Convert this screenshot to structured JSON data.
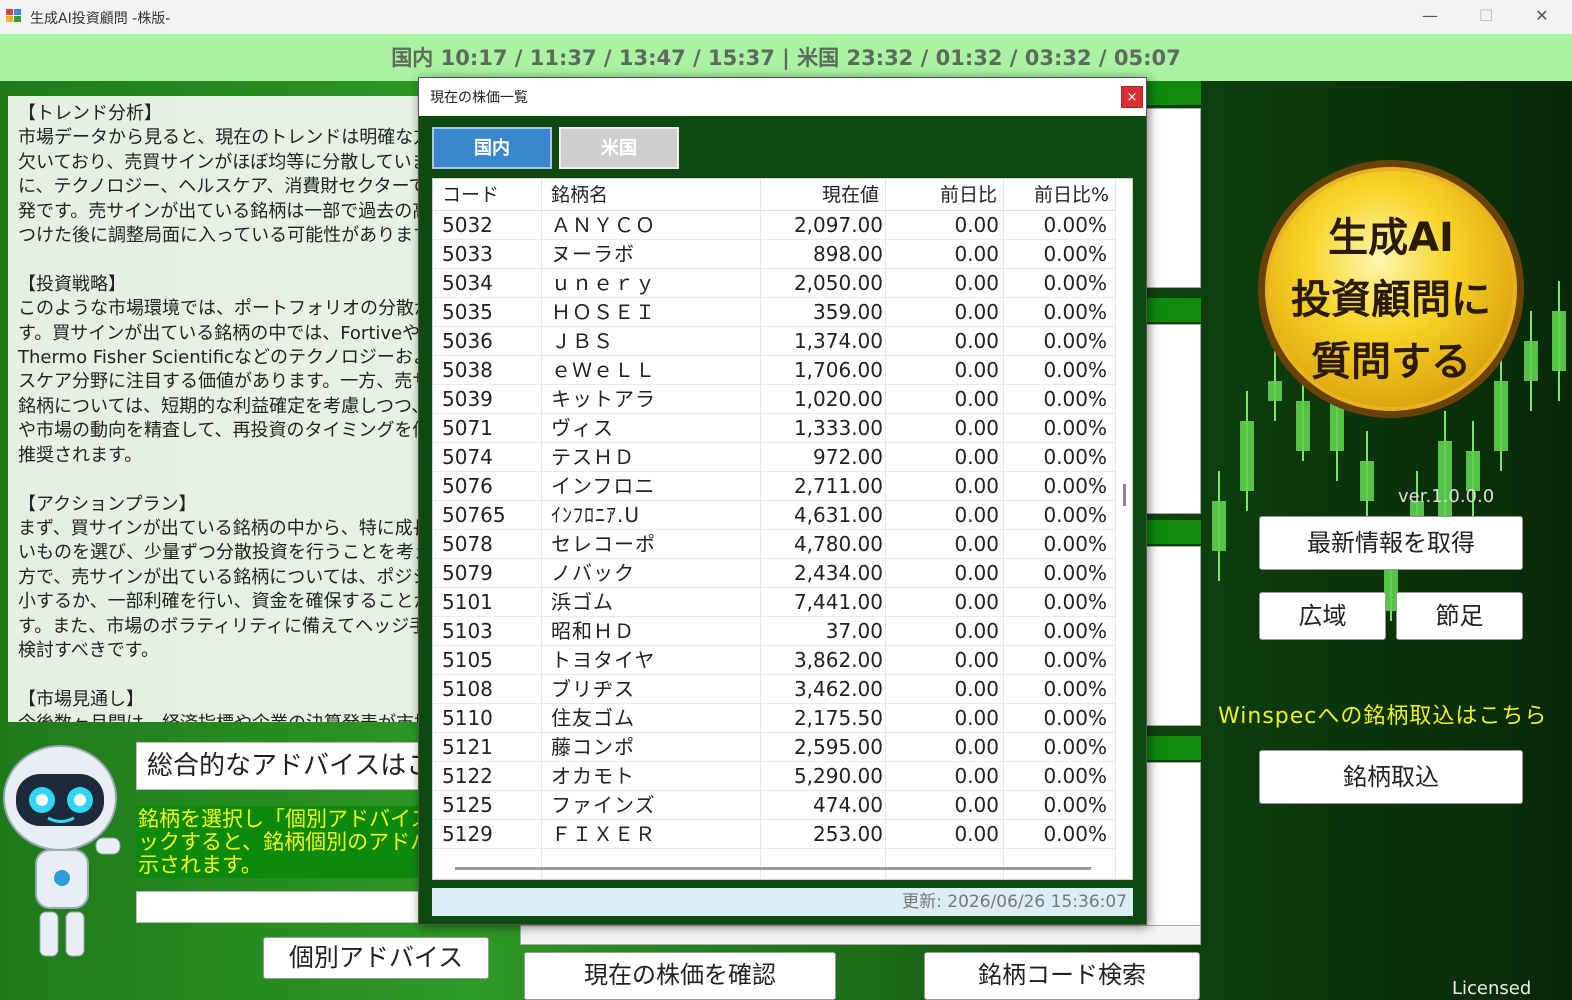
{
  "window": {
    "title": "生成AI投資顧問 -株版-",
    "minimize": "—",
    "maximize": "☐",
    "close": "✕"
  },
  "timebar": {
    "text": "国内 10:17 / 11:37 / 13:47 / 15:37  |  米国 23:32 / 01:32 / 03:32 / 05:07"
  },
  "analysis": {
    "text": "【トレンド分析】\n市場データから見ると、現在のトレンドは明確な方向性を\n欠いており、売買サインがほぼ均等に分散しています。特\nに、テクノロジー、ヘルスケア、消費財セクターでの売買が活\n発です。売サインが出ている銘柄は一部で過去の高値を\nつけた後に調整局面に入っている可能性があります。\n\n【投資戦略】\nこのような市場環境では、ポートフォリオの分散が重要で\nす。買サインが出ている銘柄の中では、Fortiveや\nThermo Fisher Scientificなどのテクノロジーおよびヘル\nスケア分野に注目する価値があります。一方、売サインの\n銘柄については、短期的な利益確定を考慮しつつ、業績\nや市場の動向を精査して、再投資のタイミングを伺うことが\n推奨されます。\n\n【アクションプラン】\nまず、買サインが出ている銘柄の中から、特に成長性の高\nいものを選び、少量ずつ分散投資を行うことを考えます。一\n方で、売サインが出ている銘柄については、ポジションを縮\n小するか、一部利確を行い、資金を確保することが重要で\nす。また、市場のボラティリティに備えてヘッジ手法の導入も\n検討すべきです。\n\n【市場見通し】\n今後数ヶ月間は、経済指標や企業の決算発表が市場"
  },
  "advice": {
    "title": "総合的なアドバイスはこちら",
    "hint": "銘柄を選択し「個別アドバイス」をクリ\nックすると、銘柄個別のアドバイスが表\n示されます。",
    "input_value": "",
    "individual_button": "個別アドバイス"
  },
  "bottom": {
    "check_price_button": "現在の株価を確認",
    "code_search_button": "銘柄コード検索"
  },
  "right": {
    "ask_ai": "生成AI\n投資顧問に\n質問する",
    "version": "ver.1.0.0.0",
    "latest_button": "最新情報を取得",
    "wide_button": "広域",
    "ashi_button": "節足",
    "winspec_label": "Winspecへの銘柄取込はこちら",
    "import_button": "銘柄取込",
    "licensed": "Licensed"
  },
  "popup": {
    "title": "現在の株価一覧",
    "close": "×",
    "tabs": [
      "国内",
      "米国"
    ],
    "columns": [
      "コード",
      "銘柄名",
      "現在値",
      "前日比",
      "前日比%"
    ],
    "rows": [
      [
        "5032",
        "ＡＮＹＣＯ",
        "2,097.00",
        "0.00",
        "0.00%"
      ],
      [
        "5033",
        "ヌーラボ",
        "898.00",
        "0.00",
        "0.00%"
      ],
      [
        "5034",
        "ｕｎｅｒｙ",
        "2,050.00",
        "0.00",
        "0.00%"
      ],
      [
        "5035",
        "ＨＯＳＥＩ",
        "359.00",
        "0.00",
        "0.00%"
      ],
      [
        "5036",
        "ＪＢＳ",
        "1,374.00",
        "0.00",
        "0.00%"
      ],
      [
        "5038",
        "ｅＷｅＬＬ",
        "1,706.00",
        "0.00",
        "0.00%"
      ],
      [
        "5039",
        "キットアラ",
        "1,020.00",
        "0.00",
        "0.00%"
      ],
      [
        "5071",
        "ヴィス",
        "1,333.00",
        "0.00",
        "0.00%"
      ],
      [
        "5074",
        "テスＨＤ",
        "972.00",
        "0.00",
        "0.00%"
      ],
      [
        "5076",
        "インフロニ",
        "2,711.00",
        "0.00",
        "0.00%"
      ],
      [
        "50765",
        "ｲﾝﾌﾛﾆｱ.U",
        "4,631.00",
        "0.00",
        "0.00%"
      ],
      [
        "5078",
        "セレコーポ",
        "4,780.00",
        "0.00",
        "0.00%"
      ],
      [
        "5079",
        "ノバック",
        "2,434.00",
        "0.00",
        "0.00%"
      ],
      [
        "5101",
        "浜ゴム",
        "7,441.00",
        "0.00",
        "0.00%"
      ],
      [
        "5103",
        "昭和ＨＤ",
        "37.00",
        "0.00",
        "0.00%"
      ],
      [
        "5105",
        "トヨタイヤ",
        "3,862.00",
        "0.00",
        "0.00%"
      ],
      [
        "5108",
        "ブリヂス",
        "3,462.00",
        "0.00",
        "0.00%"
      ],
      [
        "5110",
        "住友ゴム",
        "2,175.50",
        "0.00",
        "0.00%"
      ],
      [
        "5121",
        "藤コンポ",
        "2,595.00",
        "0.00",
        "0.00%"
      ],
      [
        "5122",
        "オカモト",
        "5,290.00",
        "0.00",
        "0.00%"
      ],
      [
        "5125",
        "ファインズ",
        "474.00",
        "0.00",
        "0.00%"
      ],
      [
        "5129",
        "ＦＩＸＥＲ",
        "253.00",
        "0.00",
        "0.00%"
      ]
    ],
    "status": "更新: 2026/06/26 15:36:07"
  },
  "colors": {
    "timebar": "#a9f3a2",
    "tab_active": "#3a87cd",
    "tab_inactive": "#cfcfcf",
    "hint_bg": "#0c8a0c",
    "hint_text": "#f6f61c",
    "winspec_text": "#f2f21a",
    "close_button": "#d63030"
  },
  "icons": {
    "app": "app-icon",
    "robot": "robot-mascot"
  }
}
